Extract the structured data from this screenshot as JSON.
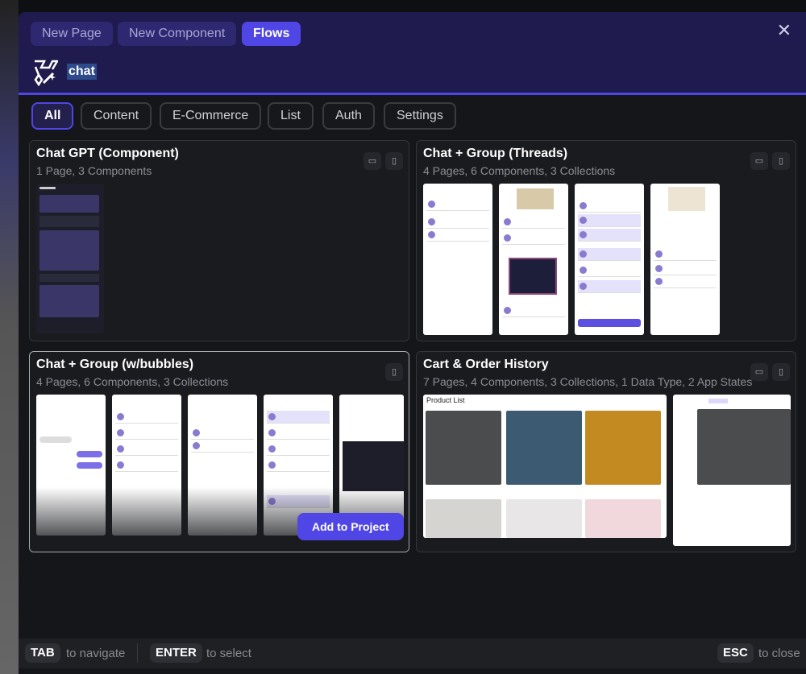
{
  "tabs": [
    {
      "label": "New Page"
    },
    {
      "label": "New Component"
    },
    {
      "label": "Flows",
      "active": true
    }
  ],
  "search": {
    "value": "chat",
    "icon": "flows-magic-icon"
  },
  "filters": [
    {
      "label": "All",
      "active": true
    },
    {
      "label": "Content"
    },
    {
      "label": "E-Commerce"
    },
    {
      "label": "List"
    },
    {
      "label": "Auth"
    },
    {
      "label": "Settings"
    }
  ],
  "cards": [
    {
      "title": "Chat GPT (Component)",
      "subtitle": "1 Page, 3 Components",
      "devices": [
        "desktop",
        "mobile"
      ]
    },
    {
      "title": "Chat + Group (Threads)",
      "subtitle": "4 Pages, 6 Components, 3 Collections",
      "devices": [
        "desktop",
        "mobile"
      ]
    },
    {
      "title": "Chat + Group (w/bubbles)",
      "subtitle": "4 Pages, 6 Components, 3 Collections",
      "devices": [
        "mobile"
      ],
      "hovered": true,
      "action": "Add to Project"
    },
    {
      "title": "Cart & Order History",
      "subtitle": "7 Pages, 4 Components, 3 Collections, 1 Data Type, 2 App States",
      "devices": [
        "desktop",
        "mobile"
      ],
      "preview_title": "Product List"
    }
  ],
  "footer": {
    "tab_key": "TAB",
    "tab_hint": "to navigate",
    "enter_key": "ENTER",
    "enter_hint": "to select",
    "esc_key": "ESC",
    "esc_hint": "to close"
  },
  "colors": {
    "accent": "#4f46e5",
    "header_bg": "#1f1b4f",
    "modal_bg": "#151619"
  }
}
